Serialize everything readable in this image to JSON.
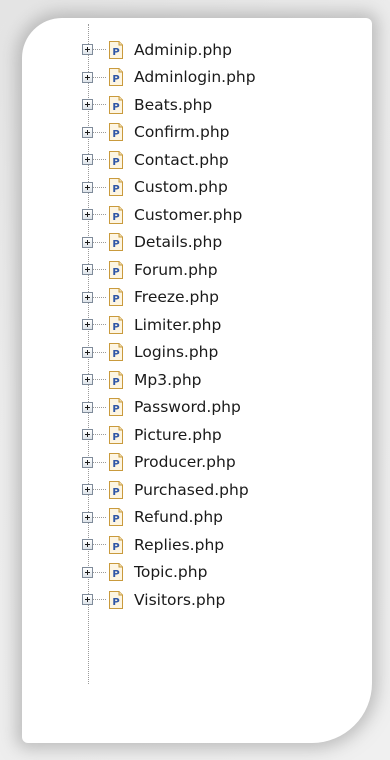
{
  "tree": {
    "icon": "php-file-icon",
    "accent": "#d9a94a",
    "items": [
      {
        "label": "Adminip.php"
      },
      {
        "label": "Adminlogin.php"
      },
      {
        "label": "Beats.php"
      },
      {
        "label": "Confirm.php"
      },
      {
        "label": "Contact.php"
      },
      {
        "label": "Custom.php"
      },
      {
        "label": "Customer.php"
      },
      {
        "label": "Details.php"
      },
      {
        "label": "Forum.php"
      },
      {
        "label": "Freeze.php"
      },
      {
        "label": "Limiter.php"
      },
      {
        "label": "Logins.php"
      },
      {
        "label": "Mp3.php"
      },
      {
        "label": "Password.php"
      },
      {
        "label": "Picture.php"
      },
      {
        "label": "Producer.php"
      },
      {
        "label": "Purchased.php"
      },
      {
        "label": "Refund.php"
      },
      {
        "label": "Replies.php"
      },
      {
        "label": "Topic.php"
      },
      {
        "label": "Visitors.php"
      }
    ]
  }
}
